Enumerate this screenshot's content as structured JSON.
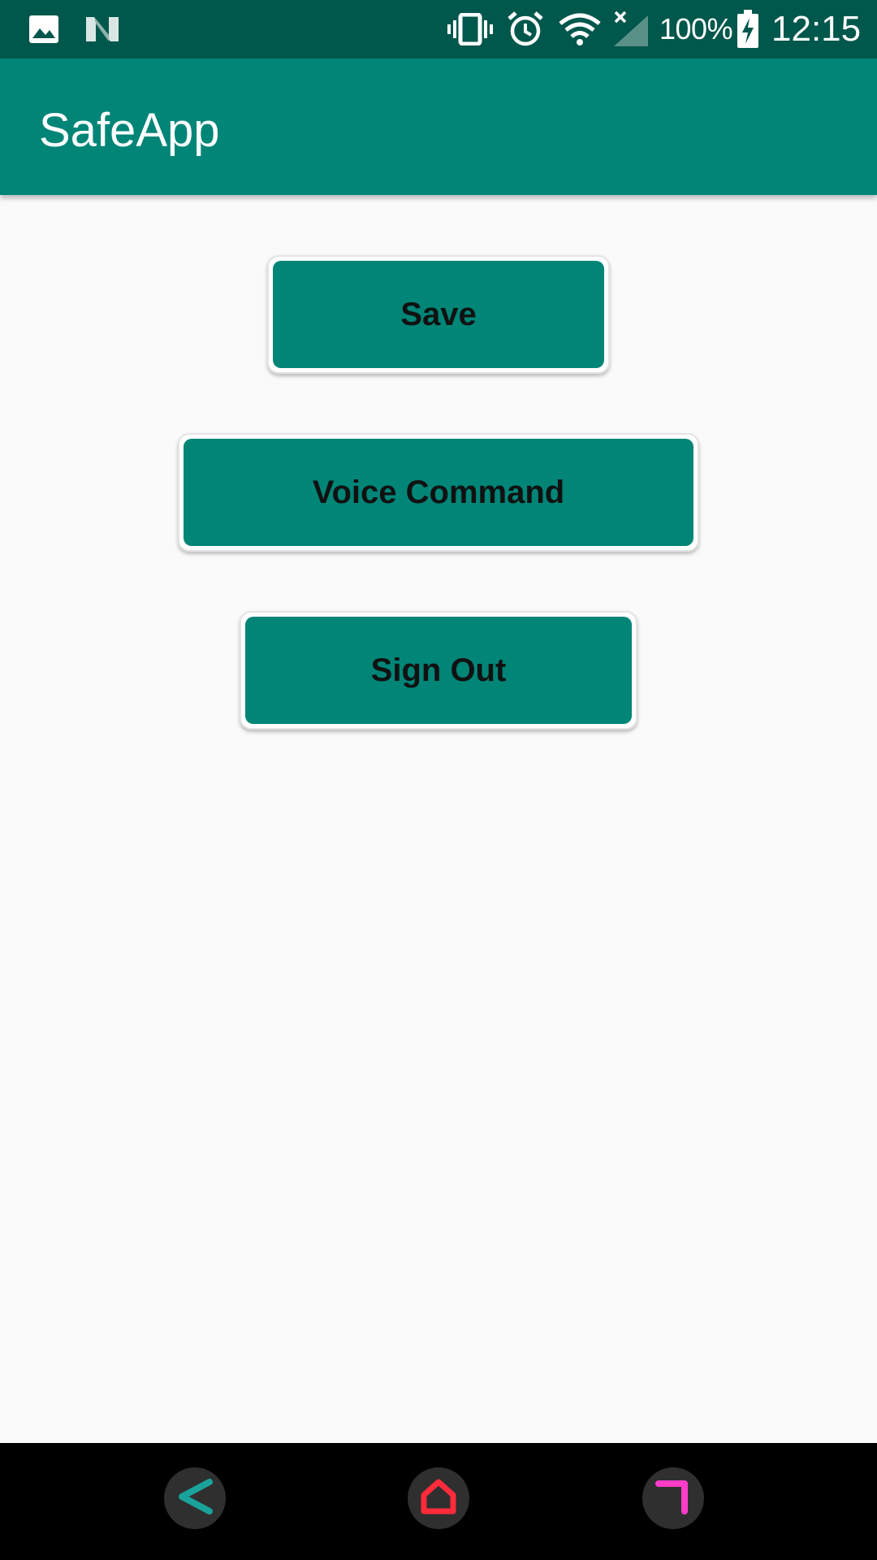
{
  "status_bar": {
    "icons": [
      "image-icon",
      "n-logo-icon",
      "vibrate-icon",
      "alarm-icon",
      "wifi-icon",
      "signal-icon",
      "battery-charging-icon"
    ],
    "battery_percent": "100%",
    "time": "12:15"
  },
  "app_bar": {
    "title": "SafeApp"
  },
  "buttons": {
    "save": "Save",
    "voice_command": "Voice Command",
    "sign_out": "Sign Out"
  },
  "nav_bar": {
    "icons": [
      "back-icon",
      "home-icon",
      "recents-icon"
    ]
  },
  "colors": {
    "status_bar": "#00574b",
    "primary": "#008577",
    "background": "#fafafa",
    "back_accent": "#1aa39b",
    "home_accent": "#ff2a3a",
    "recents_accent": "#ff3cc8"
  }
}
